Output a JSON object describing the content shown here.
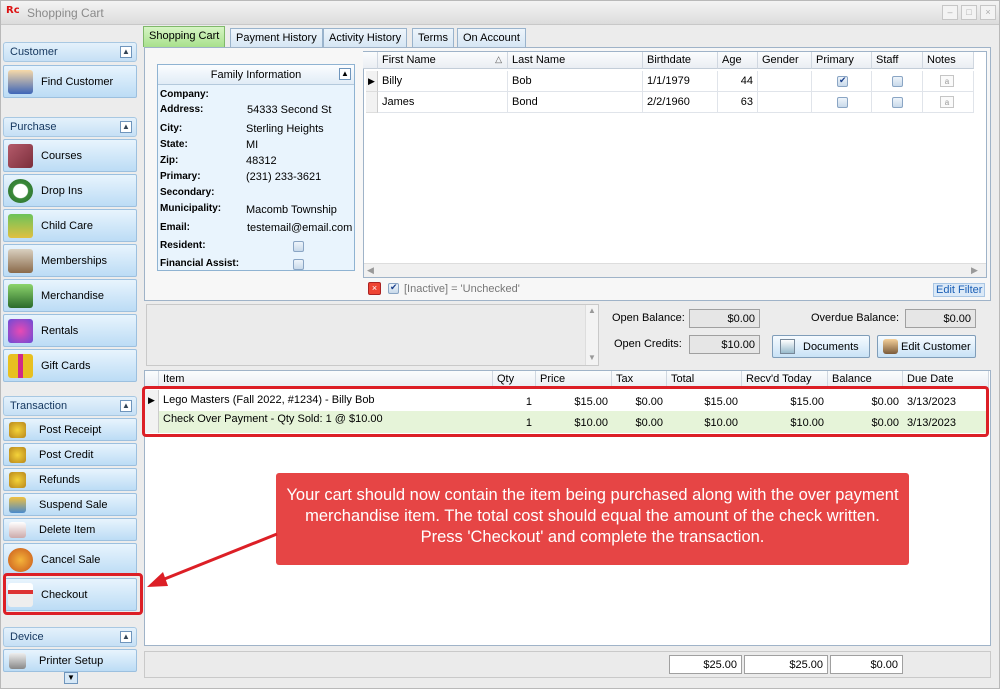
{
  "window": {
    "title": "Shopping Cart",
    "logo": "Rc"
  },
  "tabs": [
    {
      "label": "Shopping Cart",
      "active": true
    },
    {
      "label": "Payment History"
    },
    {
      "label": "Activity History"
    },
    {
      "label": "Terms"
    },
    {
      "label": "On Account"
    }
  ],
  "sidebar": {
    "customer": {
      "title": "Customer",
      "items": [
        {
          "label": "Find Customer",
          "icon": "person-icon"
        }
      ]
    },
    "purchase": {
      "title": "Purchase",
      "items": [
        {
          "label": "Courses",
          "icon": "book-icon"
        },
        {
          "label": "Drop Ins",
          "icon": "clock-icon"
        },
        {
          "label": "Child Care",
          "icon": "swing-icon"
        },
        {
          "label": "Memberships",
          "icon": "card-icon"
        },
        {
          "label": "Merchandise",
          "icon": "merchandise-icon"
        },
        {
          "label": "Rentals",
          "icon": "rentals-icon"
        },
        {
          "label": "Gift Cards",
          "icon": "gift-icon"
        }
      ]
    },
    "transaction": {
      "title": "Transaction",
      "items": [
        {
          "label": "Post Receipt",
          "icon": "coins-icon"
        },
        {
          "label": "Post Credit",
          "icon": "coins-icon"
        },
        {
          "label": "Refunds",
          "icon": "coins-icon"
        },
        {
          "label": "Suspend Sale",
          "icon": "suspend-icon"
        },
        {
          "label": "Delete Item",
          "icon": "delete-icon"
        },
        {
          "label": "Cancel Sale",
          "icon": "cancel-icon"
        },
        {
          "label": "Checkout",
          "icon": "checkout-icon"
        }
      ]
    },
    "device": {
      "title": "Device",
      "items": [
        {
          "label": "Printer Setup",
          "icon": "printer-icon"
        }
      ]
    }
  },
  "family": {
    "header": "Family Information",
    "labels": {
      "company": "Company:",
      "address": "Address:",
      "city": "City:",
      "state": "State:",
      "zip": "Zip:",
      "primary": "Primary:",
      "secondary": "Secondary:",
      "municipality": "Municipality:",
      "email": "Email:",
      "resident": "Resident:",
      "financial_assist": "Financial Assist:"
    },
    "values": {
      "company": "",
      "address": "54333 Second St",
      "city": "Sterling Heights",
      "state": "MI",
      "zip": "48312",
      "primary": "(231) 233-3621",
      "secondary": "",
      "municipality": "Macomb Township",
      "email": "testemail@email.com"
    },
    "resident": false,
    "financial_assist": false
  },
  "members": {
    "columns": [
      "First Name",
      "Last Name",
      "Birthdate",
      "Age",
      "Gender",
      "Primary",
      "Staff",
      "Notes"
    ],
    "rows": [
      {
        "first": "Billy",
        "last": "Bob",
        "birthdate": "1/1/1979",
        "age": "44",
        "gender": "",
        "primary": true,
        "staff": false
      },
      {
        "first": "James",
        "last": "Bond",
        "birthdate": "2/2/1960",
        "age": "63",
        "gender": "",
        "primary": false,
        "staff": false
      }
    ],
    "filter_text": "[Inactive] = 'Unchecked'",
    "edit_filter": "Edit Filter"
  },
  "balances": {
    "open_balance_label": "Open Balance:",
    "open_balance": "$0.00",
    "overdue_balance_label": "Overdue Balance:",
    "overdue_balance": "$0.00",
    "open_credits_label": "Open Credits:",
    "open_credits": "$10.00",
    "documents_label": "Documents",
    "edit_customer_label": "Edit Customer"
  },
  "cart": {
    "columns": [
      "Item",
      "Qty",
      "Price",
      "Tax",
      "Total",
      "Recv'd Today",
      "Balance",
      "Due Date"
    ],
    "rows": [
      {
        "item": "Lego Masters (Fall  2022, #1234) - Billy Bob",
        "qty": "1",
        "price": "$15.00",
        "tax": "$0.00",
        "total": "$15.00",
        "recvd": "$15.00",
        "balance": "$0.00",
        "due": "3/13/2023"
      },
      {
        "item": "Check Over Payment - Qty Sold: 1 @ $10.00",
        "qty": "1",
        "price": "$10.00",
        "tax": "$0.00",
        "total": "$10.00",
        "recvd": "$10.00",
        "balance": "$0.00",
        "due": "3/13/2023"
      }
    ],
    "totals": {
      "total": "$25.00",
      "recvd": "$25.00",
      "balance": "$0.00"
    }
  },
  "callout": "Your cart should now contain the item being purchased along with the over payment merchandise item. The total cost should equal the amount of the check written.  Press 'Checkout' and complete the transaction."
}
